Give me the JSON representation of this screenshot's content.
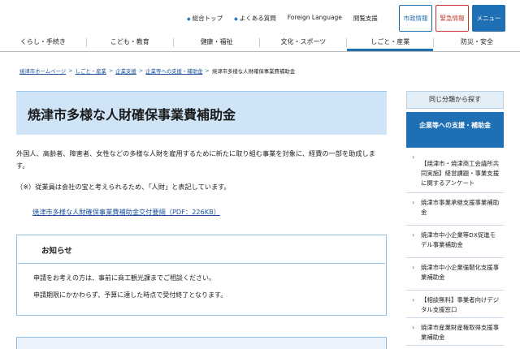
{
  "util": {
    "links": [
      "総合トップ",
      "よくある質問",
      "Foreign Language",
      "閲覧支援"
    ],
    "shisei_label": "市政情報",
    "kinkyu_label": "緊急情報",
    "menu_label": "メニュー"
  },
  "nav": {
    "items": [
      "くらし・手続き",
      "こども・教育",
      "健康・福祉",
      "文化・スポーツ",
      "しごと・産業",
      "防災・安全"
    ],
    "active_index": 4
  },
  "breadcrumb": [
    "焼津市ホームページ",
    "しごと・産業",
    "企業支援",
    "企業等への支援・補助金",
    "焼津市多様な人財確保事業費補助金"
  ],
  "page": {
    "title": "焼津市多様な人財確保事業費補助金",
    "p1": "外国人、高齢者、障害者、女性などの多様な人財を雇用するために新たに取り組む事業を対象に、経費の一部を助成します。",
    "p2": "（※）従業員は会社の宝と考えられるため、「人財」と表記しています。",
    "doc_link": "焼津市多様な人財確保事業費補助金交付要綱（PDF：226KB）"
  },
  "notice": {
    "heading": "お知らせ",
    "line1": "申請をお考えの方は、事前に商工観光課までご相談ください。",
    "line2": "申請期限にかかわらず、予算に達した時点で受付終了となります。"
  },
  "sidebar": {
    "heading": "同じ分類から探す",
    "category": "企業等への支援・補助金",
    "items": [
      "【焼津市・焼津商工会議所共同実施】経営課題・事業支援に関するアンケート",
      "焼津市事業承継支援事業補助金",
      "焼津市中小企業等DX促進モデル事業補助金",
      "焼津市中小企業強靭化支援事業補助金",
      "【相談無料】事業者向けデジタル支援窓口",
      "焼津市産業財産権取得支援事業補助金"
    ]
  },
  "colors": {
    "accent": "#1f6fb5",
    "title_bg": "#cfe5f7",
    "alert": "#c0392b"
  }
}
